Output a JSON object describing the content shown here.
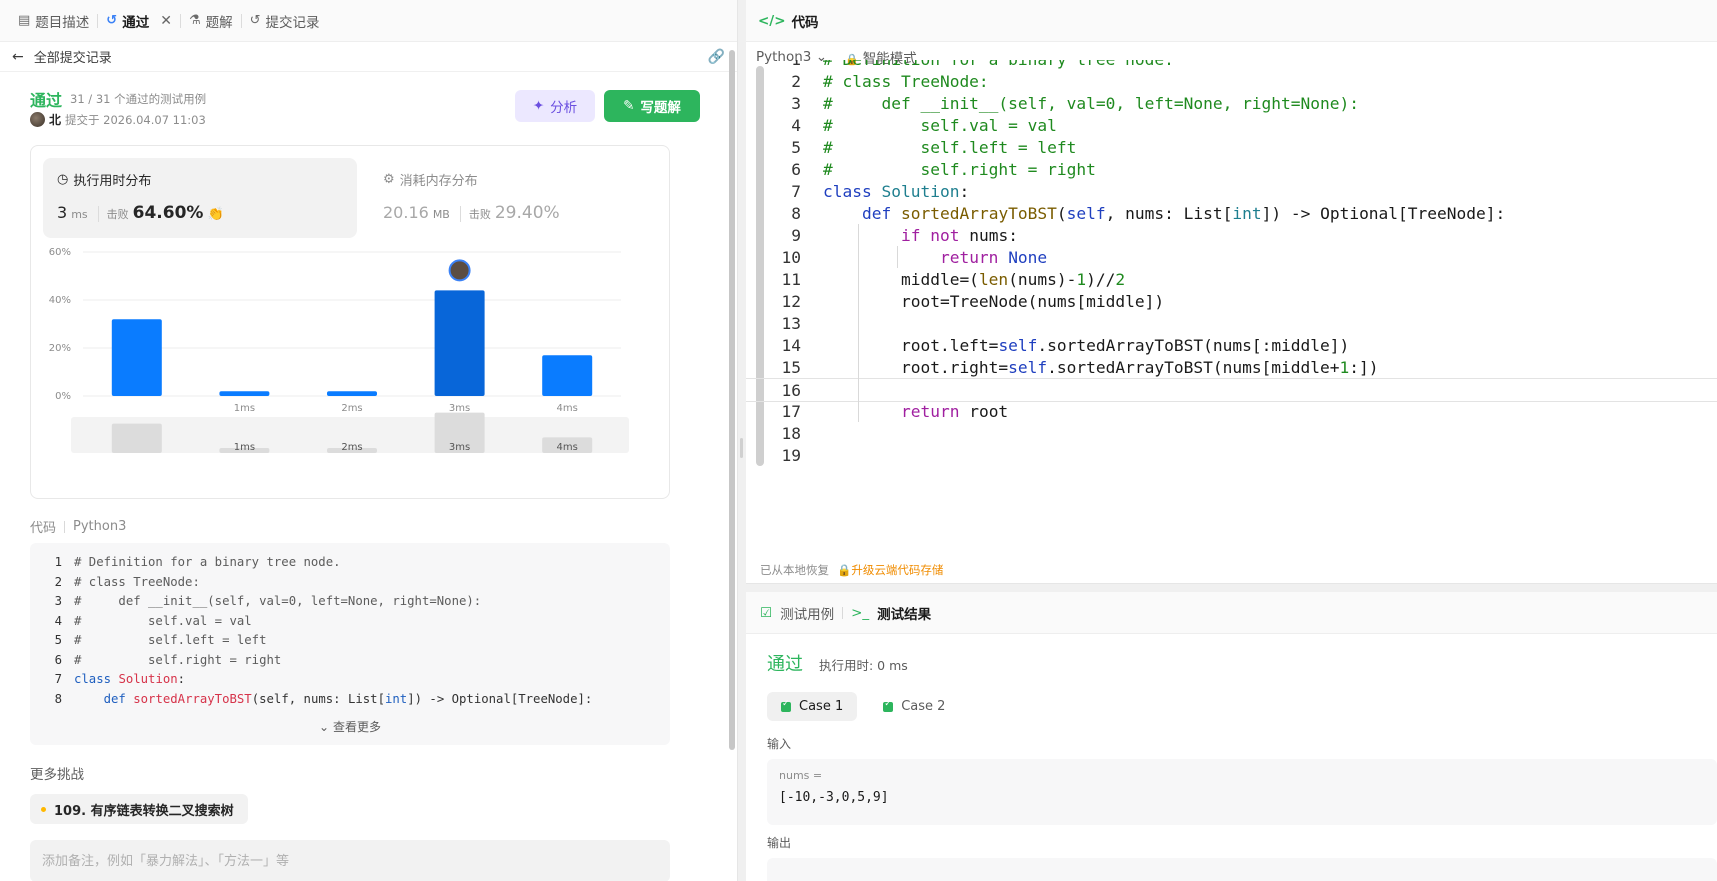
{
  "left_tabs": [
    {
      "label": "题目描述",
      "icon": "description-icon"
    },
    {
      "label": "通过",
      "icon": "history-icon"
    },
    {
      "label": "题解",
      "icon": "flask-icon"
    },
    {
      "label": "提交记录",
      "icon": "history-icon"
    }
  ],
  "back": {
    "label": "全部提交记录"
  },
  "submission": {
    "status": "通过",
    "tests": "31 / 31 个通过的测试用例",
    "user": "北",
    "submitted_at": "提交于 2026.04.07 11:03"
  },
  "buttons": {
    "analyze": "分析",
    "write_solution": "写题解"
  },
  "runtime": {
    "title": "执行用时分布",
    "value": "3",
    "unit": "ms",
    "beat_label": "击败",
    "beat": "64.60%"
  },
  "memory": {
    "title": "消耗内存分布",
    "value": "20.16",
    "unit": "MB",
    "beat_label": "击败",
    "beat": "29.40%"
  },
  "chart_data": {
    "type": "bar",
    "categories": [
      "",
      "1ms",
      "2ms",
      "3ms",
      "4ms"
    ],
    "values": [
      32,
      2,
      2,
      44,
      17
    ],
    "ylim": [
      0,
      60
    ],
    "yticks": [
      "0%",
      "20%",
      "40%",
      "60%"
    ],
    "highlight_index": 3,
    "colors": {
      "bar": "#0a7cff",
      "highlight": "#0866d9"
    }
  },
  "code_preview": {
    "label": "代码",
    "lang": "Python3",
    "lines": [
      "# Definition for a binary tree node.",
      "# class TreeNode:",
      "#     def __init__(self, val=0, left=None, right=None):",
      "#         self.val = val",
      "#         self.left = left",
      "#         self.right = right",
      "class Solution:",
      "    def sortedArrayToBST(self, nums: List[int]) -> Optional[TreeNode]:"
    ],
    "see_more": "查看更多"
  },
  "more": {
    "title": "更多挑战",
    "item": "109. 有序链表转换二叉搜索树"
  },
  "note_placeholder": "添加备注，例如「暴力解法」、「方法一」等",
  "editor": {
    "title": "代码",
    "lang": "Python3",
    "mode": "智能模式",
    "first_line_partial": "# Definition for a binary tree node.",
    "lines": [
      "# Definition for a binary tree node.",
      "# class TreeNode:",
      "#     def __init__(self, val=0, left=None, right=None):",
      "#         self.val = val",
      "#         self.left = left",
      "#         self.right = right",
      "class Solution:",
      "    def sortedArrayToBST(self, nums: List[int]) -> Optional[TreeNode]:",
      "        if not nums:",
      "            return None",
      "        middle=(len(nums)-1)//2",
      "        root=TreeNode(nums[middle])",
      "",
      "        root.left=self.sortedArrayToBST(nums[:middle])",
      "        root.right=self.sortedArrayToBST(nums[middle+1:])",
      "",
      "        return root",
      "",
      ""
    ],
    "restore_note": "已从本地恢复",
    "upgrade": "升级云端代码存储"
  },
  "testpanel": {
    "tab_cases": "测试用例",
    "tab_result": "测试结果",
    "status": "通过",
    "time": "执行用时: 0 ms",
    "cases": [
      "Case 1",
      "Case 2"
    ],
    "input_label": "输入",
    "input_var": "nums =",
    "input_value": "[-10,-3,0,5,9]",
    "output_label": "输出"
  }
}
